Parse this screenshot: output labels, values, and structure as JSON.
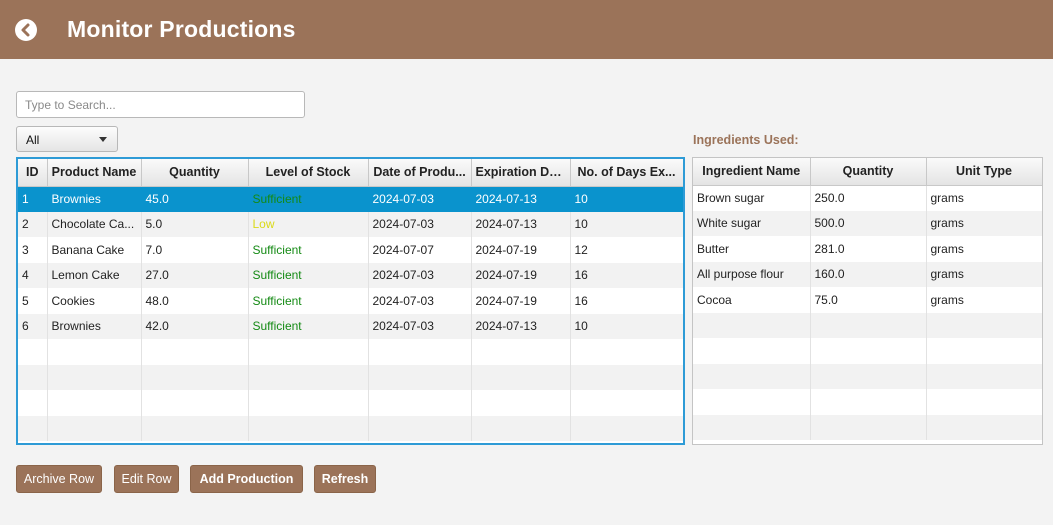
{
  "header": {
    "title": "Monitor Productions"
  },
  "search": {
    "placeholder": "Type to Search..."
  },
  "filter": {
    "selected": "All"
  },
  "productions": {
    "columns": [
      "ID",
      "Product Name",
      "Quantity",
      "Level of Stock",
      "Date of Produ...",
      "Expiration Date",
      "No. of Days Ex..."
    ],
    "rows": [
      [
        "1",
        "Brownies",
        "45.0",
        "Sufficient",
        "2024-07-03",
        "2024-07-13",
        "10"
      ],
      [
        "2",
        "Chocolate Ca...",
        "5.0",
        "Low",
        "2024-07-03",
        "2024-07-13",
        "10"
      ],
      [
        "3",
        "Banana Cake",
        "7.0",
        "Sufficient",
        "2024-07-07",
        "2024-07-19",
        "12"
      ],
      [
        "4",
        "Lemon Cake",
        "27.0",
        "Sufficient",
        "2024-07-03",
        "2024-07-19",
        "16"
      ],
      [
        "5",
        "Cookies",
        "48.0",
        "Sufficient",
        "2024-07-03",
        "2024-07-19",
        "16"
      ],
      [
        "6",
        "Brownies",
        "42.0",
        "Sufficient",
        "2024-07-03",
        "2024-07-13",
        "10"
      ]
    ],
    "selected_row": 0
  },
  "ingredients": {
    "label": "Ingredients Used:",
    "columns": [
      "Ingredient Name",
      "Quantity",
      "Unit Type"
    ],
    "rows": [
      [
        "Brown sugar",
        "250.0",
        "grams"
      ],
      [
        "White sugar",
        "500.0",
        "grams"
      ],
      [
        "Butter",
        "281.0",
        "grams"
      ],
      [
        "All purpose flour",
        "160.0",
        "grams"
      ],
      [
        "Cocoa",
        "75.0",
        "grams"
      ]
    ]
  },
  "actions": {
    "archive_label": "Archive Row",
    "edit_label": "Edit Row",
    "add_label": "Add Production",
    "refresh_label": "Refresh"
  },
  "colors": {
    "brand": "#9b7359",
    "selection": "#0a93cd",
    "stock_sufficient": "#148a14",
    "stock_low": "#dada18"
  },
  "icons": {
    "back": "back-arrow-circle-icon"
  }
}
